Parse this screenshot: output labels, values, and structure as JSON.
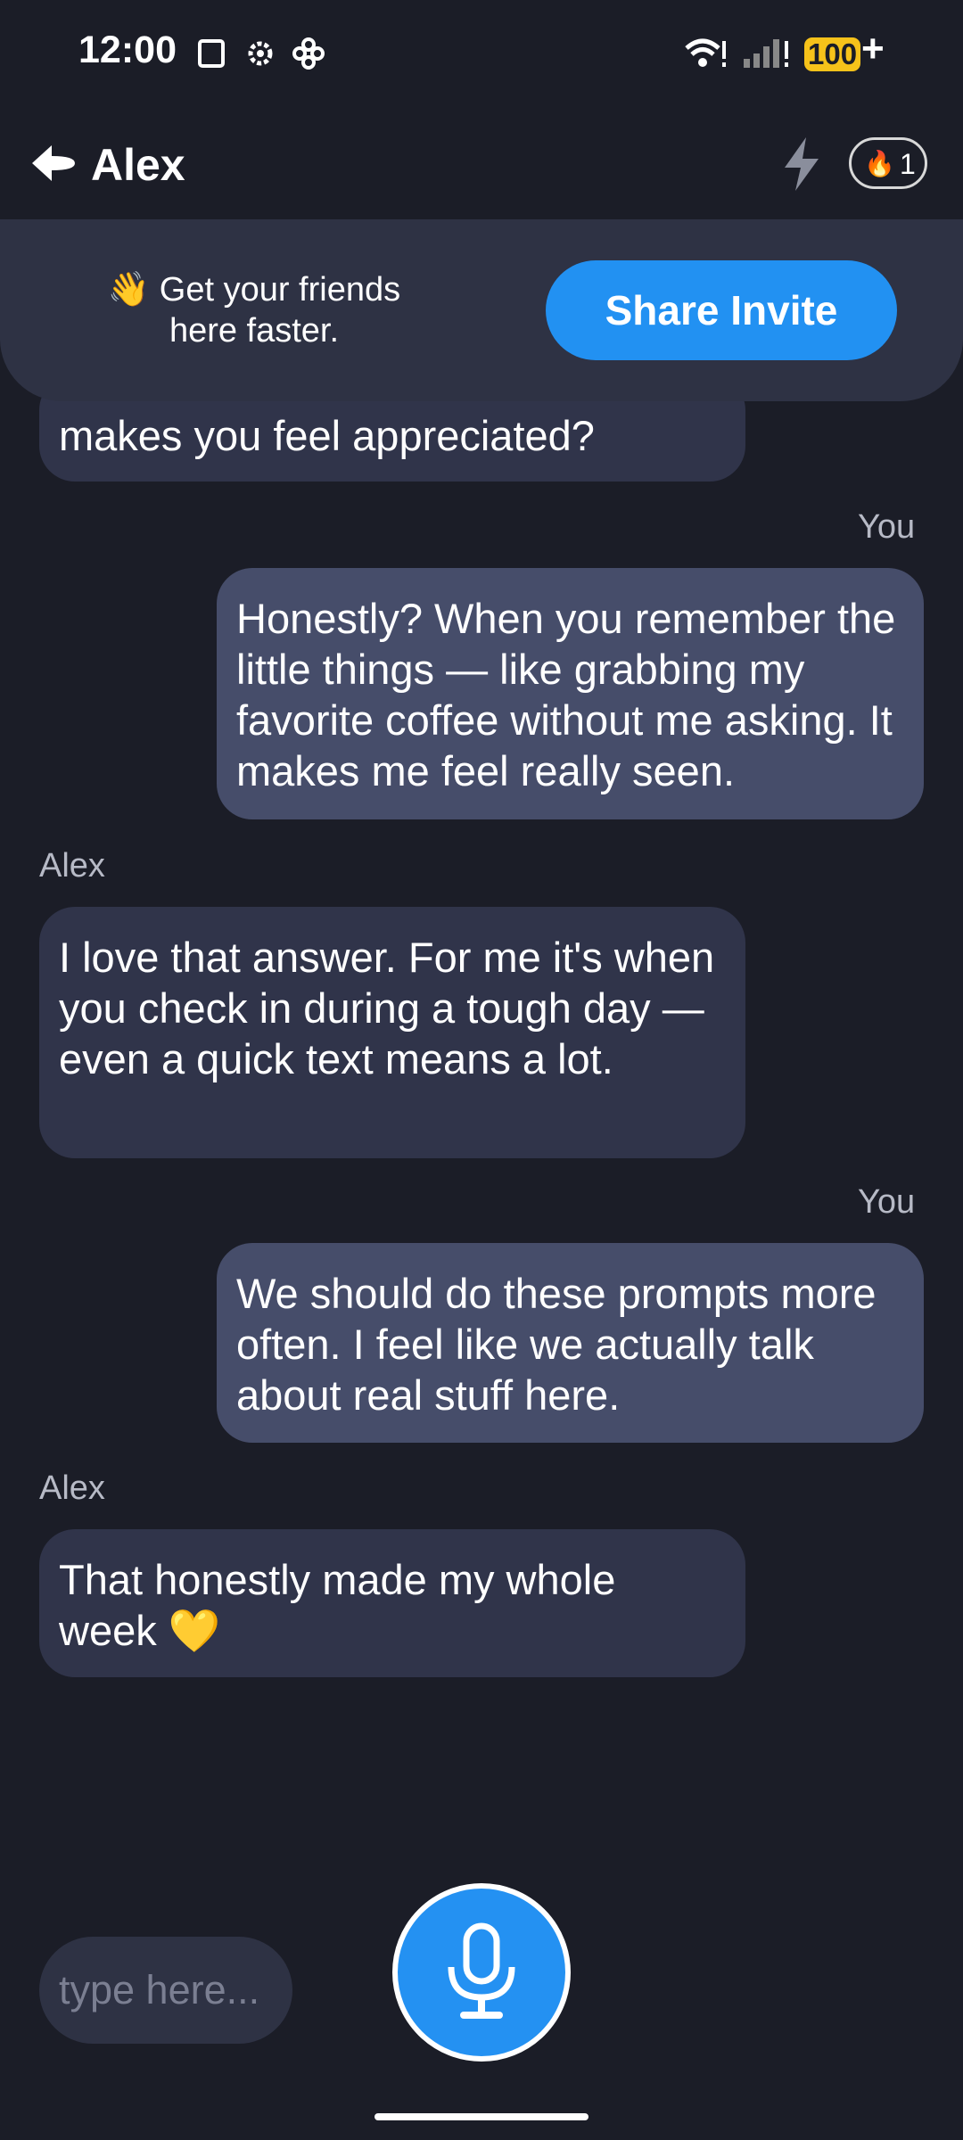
{
  "status_bar": {
    "time": "12:00",
    "battery": "100",
    "battery_plus": "+"
  },
  "header": {
    "title": "Alex",
    "streak_count": "1"
  },
  "invite": {
    "line1": "👋 Get your friends",
    "line2": "here faster.",
    "button": "Share Invite"
  },
  "messages": [
    {
      "sender": "",
      "text": "makes you feel appreciated?"
    },
    {
      "sender": "You",
      "text": "Honestly? When you remember the little things — like grabbing my favorite coffee without me asking. It makes me feel really seen."
    },
    {
      "sender": "Alex",
      "text": "I love that answer. For me it's when you check in during a tough day — even a quick text means a lot."
    },
    {
      "sender": "You",
      "text": "We should do these prompts more often. I feel like we actually talk about real stuff here."
    },
    {
      "sender": "Alex",
      "text": "That honestly made my whole week 💛"
    }
  ],
  "composer": {
    "placeholder": "type here..."
  },
  "colors": {
    "background": "#1b1d27",
    "accent": "#2291f2",
    "bubble_them": "#30344a",
    "bubble_me": "#464d6a"
  }
}
